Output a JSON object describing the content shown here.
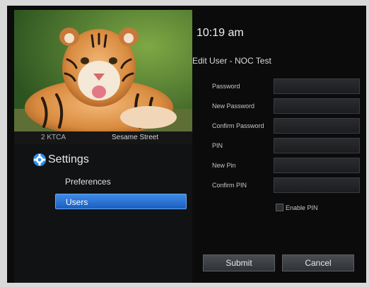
{
  "preview": {
    "channel_number": "2 KTCA",
    "program_title": "Sesame Street"
  },
  "menu": {
    "heading": "Settings",
    "items": [
      {
        "label": "Preferences",
        "selected": false
      },
      {
        "label": "Users",
        "selected": true
      }
    ]
  },
  "clock": "10:19 am",
  "form": {
    "title": "Edit User - NOC Test",
    "fields": [
      {
        "label": "Password",
        "value": ""
      },
      {
        "label": "New Password",
        "value": ""
      },
      {
        "label": "Confirm Password",
        "value": ""
      },
      {
        "label": "PIN",
        "value": ""
      },
      {
        "label": "New Pin",
        "value": ""
      },
      {
        "label": "Confirm PIN",
        "value": ""
      }
    ],
    "enable_pin_label": "Enable PIN",
    "enable_pin_checked": false,
    "submit_label": "Submit",
    "cancel_label": "Cancel"
  },
  "colors": {
    "background": "#0b0b0c",
    "selection": "#2f76d6",
    "gear_accent": "#2f8fe8"
  }
}
